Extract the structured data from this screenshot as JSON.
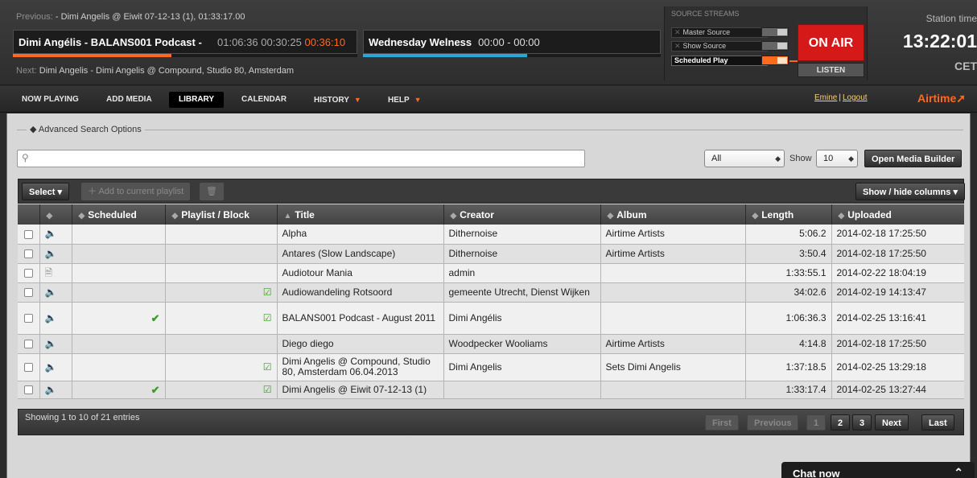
{
  "header": {
    "previous_label": "Previous:",
    "previous_value": "- Dimi Angelis @ Eiwit 07-12-13 (1), 01:33:17.00",
    "current_title": "Dimi Angélis - BALANS001 Podcast -",
    "current_elapsed": "01:06:36",
    "current_position": "00:30:25",
    "current_remaining": "00:36:10",
    "current_progress_pct": 46,
    "show_title": "Wednesday Welness",
    "show_times": "00:00 - 00:00",
    "show_progress_pct": 55,
    "next_label": "Next:",
    "next_value": "Dimi Angelis - Dimi Angelis @ Compound, Studio 80, Amsterdam",
    "colors": {
      "accent": "#ff6a1f",
      "show_progress": "#28a8d4",
      "on_air": "#d51919"
    }
  },
  "streams": {
    "heading": "SOURCE STREAMS",
    "master_source": "Master Source",
    "show_source": "Show Source",
    "scheduled_play": "Scheduled Play",
    "on_air": "ON AIR",
    "listen": "LISTEN"
  },
  "station": {
    "label": "Station time",
    "time": "13:22:01",
    "timezone": "CET"
  },
  "nav": {
    "now_playing": "NOW PLAYING",
    "add_media": "ADD MEDIA",
    "library": "LIBRARY",
    "calendar": "CALENDAR",
    "history": "HISTORY",
    "help": "HELP",
    "user": "Emine",
    "logout": "Logout",
    "logo": "Airtime"
  },
  "search": {
    "advanced_label": "Advanced Search Options",
    "placeholder": "",
    "filter_value": "All",
    "show_label": "Show",
    "show_value": "10",
    "open_builder": "Open Media Builder"
  },
  "toolbar": {
    "select": "Select",
    "add_to_playlist": "Add to current playlist",
    "show_hide_columns": "Show / hide columns"
  },
  "table": {
    "headers": [
      "",
      "",
      "Scheduled",
      "Playlist / Block",
      "Title",
      "Creator",
      "Album",
      "Length",
      "Uploaded"
    ],
    "rows": [
      {
        "type": "audio",
        "scheduled": false,
        "playlist": false,
        "title": "Alpha",
        "creator": "Dithernoise",
        "album": "Airtime Artists",
        "length": "5:06.2",
        "uploaded": "2014-02-18 17:25:50"
      },
      {
        "type": "audio",
        "scheduled": false,
        "playlist": false,
        "title": "Antares (Slow Landscape)",
        "creator": "Dithernoise",
        "album": "Airtime Artists",
        "length": "3:50.4",
        "uploaded": "2014-02-18 17:25:50"
      },
      {
        "type": "file",
        "scheduled": false,
        "playlist": false,
        "title": "Audiotour Mania",
        "creator": "admin",
        "album": "",
        "length": "1:33:55.1",
        "uploaded": "2014-02-22 18:04:19"
      },
      {
        "type": "audio",
        "scheduled": false,
        "playlist": true,
        "title": "Audiowandeling Rotsoord",
        "creator": "gemeente Utrecht, Dienst Wijken",
        "album": "",
        "length": "34:02.6",
        "uploaded": "2014-02-19 14:13:47"
      },
      {
        "type": "audio",
        "scheduled": true,
        "playlist": true,
        "title": "BALANS001 Podcast - August 2011",
        "creator": "Dimi Angélis",
        "album": "",
        "length": "1:06:36.3",
        "uploaded": "2014-02-25 13:16:41"
      },
      {
        "type": "audio",
        "scheduled": false,
        "playlist": false,
        "title": "Diego diego",
        "creator": "Woodpecker Wooliams",
        "album": "Airtime Artists",
        "length": "4:14.8",
        "uploaded": "2014-02-18 17:25:50"
      },
      {
        "type": "audio",
        "scheduled": false,
        "playlist": true,
        "title": "Dimi Angelis @ Compound, Studio 80, Amsterdam 06.04.2013",
        "creator": "Dimi Angelis",
        "album": "Sets Dimi Angelis",
        "length": "1:37:18.5",
        "uploaded": "2014-02-25 13:29:18"
      },
      {
        "type": "audio",
        "scheduled": true,
        "playlist": true,
        "title": "Dimi Angelis @ Eiwit 07-12-13 (1)",
        "creator": "",
        "album": "",
        "length": "1:33:17.4",
        "uploaded": "2014-02-25 13:27:44"
      }
    ]
  },
  "footer": {
    "info": "Showing 1 to 10 of 21 entries",
    "first": "First",
    "previous": "Previous",
    "page1": "1",
    "page2": "2",
    "page3": "3",
    "next": "Next",
    "last": "Last"
  },
  "chat": {
    "label": "Chat now"
  }
}
